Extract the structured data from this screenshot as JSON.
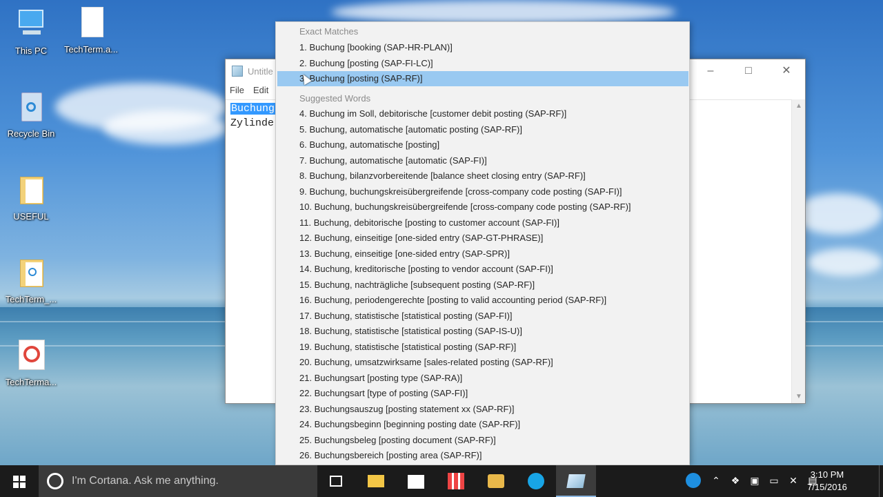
{
  "desktop": {
    "icons": [
      {
        "label": "This PC"
      },
      {
        "label": "TechTerm.a..."
      },
      {
        "label": "Recycle Bin"
      },
      {
        "label": "USEFUL"
      },
      {
        "label": "TechTerm_..."
      },
      {
        "label": "TechTerma..."
      }
    ]
  },
  "notepad": {
    "title": "Untitle",
    "menu": {
      "file": "File",
      "edit": "Edit"
    },
    "lines": [
      "Buchung",
      "Zylinde"
    ]
  },
  "dropdown": {
    "exact_header": "Exact Matches",
    "exact": [
      "1. Buchung  [booking (SAP-HR-PLAN)]",
      "2. Buchung  [posting (SAP-FI-LC)]",
      "3. Buchung  [posting (SAP-RF)]"
    ],
    "suggested_header": "Suggested Words",
    "suggested": [
      "4. Buchung im Soll, debitorische  [customer debit posting (SAP-RF)]",
      "5. Buchung, automatische  [automatic posting (SAP-RF)]",
      "6. Buchung, automatische  [posting]",
      "7. Buchung, automatische  [automatic (SAP-FI)]",
      "8. Buchung, bilanzvorbereitende  [balance sheet closing entry (SAP-RF)]",
      "9. Buchung, buchungskreisübergreifende  [cross-company code posting (SAP-FI)]",
      "10. Buchung, buchungskreisübergreifende  [cross-company code posting (SAP-RF)]",
      "11. Buchung, debitorische  [posting to customer account (SAP-FI)]",
      "12. Buchung, einseitige  [one-sided entry (SAP-GT-PHRASE)]",
      "13. Buchung, einseitige  [one-sided entry (SAP-SPR)]",
      "14. Buchung, kreditorische  [posting to vendor account (SAP-FI)]",
      "15. Buchung, nachträgliche  [subsequent posting (SAP-RF)]",
      "16. Buchung, periodengerechte  [posting to valid accounting period (SAP-RF)]",
      "17. Buchung, statistische  [statistical posting (SAP-FI)]",
      "18. Buchung, statistische  [statistical posting (SAP-IS-U)]",
      "19. Buchung, statistische  [statistical posting (SAP-RF)]",
      "20. Buchung, umsatzwirksame  [sales-related posting (SAP-RF)]",
      "21. Buchungsart  [posting type (SAP-RA)]",
      "22. Buchungsart  [type of posting (SAP-FI)]",
      "23. Buchungsauszug  [posting statement xx (SAP-RF)]",
      "24. Buchungsbeginn  [beginning posting date (SAP-RF)]",
      "25. Buchungsbeleg  [posting document (SAP-RF)]",
      "26. Buchungsbereich  [posting area (SAP-RF)]"
    ]
  },
  "taskbar": {
    "cortana_placeholder": "I'm Cortana. Ask me anything.",
    "time": "3:10 PM",
    "date": "7/15/2016"
  },
  "colors": {
    "selection": "#99c9f1",
    "taskbar": "#1b1b1b",
    "text_selection": "#3399ff"
  }
}
